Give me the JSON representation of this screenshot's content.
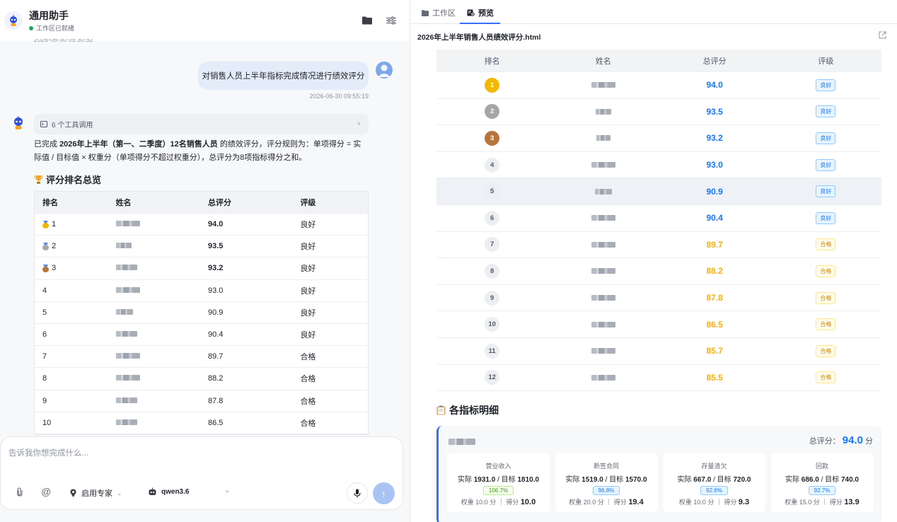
{
  "app": {
    "title": "通用助手",
    "status": "工作区已就绪"
  },
  "chat": {
    "prev_timestamp": "2026-06-30 09:30:52",
    "user_message": "对销售人员上半年指标完成情况进行绩效评分",
    "user_timestamp": "2026-06-30 09:55:19",
    "tool_calls": "6 个工具调用",
    "para_pre": "已完成 ",
    "para_bold": "2026年上半年（第一、二季度）12名销售人员",
    "para_post": " 的绩效评分，评分规则为：单项得分 = 实际值 / 目标值 × 权重分（单项得分不超过权重分），总评分为8项指标得分之和。",
    "section_title": "评分排名总览",
    "table": {
      "headers": [
        "排名",
        "姓名",
        "总评分",
        "评级"
      ],
      "rows": [
        {
          "rank": "1",
          "score": "94.0",
          "level": "良好"
        },
        {
          "rank": "2",
          "score": "93.5",
          "level": "良好"
        },
        {
          "rank": "3",
          "score": "93.2",
          "level": "良好"
        },
        {
          "rank": "4",
          "score": "93.0",
          "level": "良好"
        },
        {
          "rank": "5",
          "score": "90.9",
          "level": "良好"
        },
        {
          "rank": "6",
          "score": "90.4",
          "level": "良好"
        },
        {
          "rank": "7",
          "score": "89.7",
          "level": "合格"
        },
        {
          "rank": "8",
          "score": "88.2",
          "level": "合格"
        },
        {
          "rank": "9",
          "score": "87.8",
          "level": "合格"
        },
        {
          "rank": "10",
          "score": "86.5",
          "level": "合格"
        }
      ]
    }
  },
  "input": {
    "placeholder": "告诉我你想完成什么...",
    "expert": "启用专家",
    "model": "qwen3.6"
  },
  "preview": {
    "tabs": [
      "工作区",
      "预览"
    ],
    "filename": "2026年上半年销售人员绩效评分.html",
    "table_headers": [
      "排名",
      "姓名",
      "总评分",
      "评级"
    ],
    "rows": [
      {
        "rank": "1",
        "score": "94.0",
        "level": "良好"
      },
      {
        "rank": "2",
        "score": "93.5",
        "level": "良好"
      },
      {
        "rank": "3",
        "score": "93.2",
        "level": "良好"
      },
      {
        "rank": "4",
        "score": "93.0",
        "level": "良好"
      },
      {
        "rank": "5",
        "score": "90.9",
        "level": "良好"
      },
      {
        "rank": "6",
        "score": "90.4",
        "level": "良好"
      },
      {
        "rank": "7",
        "score": "89.7",
        "level": "合格"
      },
      {
        "rank": "8",
        "score": "88.2",
        "level": "合格"
      },
      {
        "rank": "9",
        "score": "87.8",
        "level": "合格"
      },
      {
        "rank": "10",
        "score": "86.5",
        "level": "合格"
      },
      {
        "rank": "11",
        "score": "85.7",
        "level": "合格"
      },
      {
        "rank": "12",
        "score": "85.5",
        "level": "合格"
      }
    ],
    "detail_title": "各指标明细",
    "card": {
      "total_label": "总评分：",
      "total_value": "94.0",
      "total_unit": "分",
      "metrics": [
        {
          "name": "营业收入",
          "actual": "1931.0",
          "target": "1810.0",
          "pct": "106.7%",
          "weight": "10.0",
          "score": "10.0"
        },
        {
          "name": "新签合同",
          "actual": "1519.0",
          "target": "1570.0",
          "pct": "96.8%",
          "weight": "20.0",
          "score": "19.4"
        },
        {
          "name": "存量清欠",
          "actual": "667.0",
          "target": "720.0",
          "pct": "92.6%",
          "weight": "10.0",
          "score": "9.3"
        },
        {
          "name": "回款",
          "actual": "686.0",
          "target": "740.0",
          "pct": "92.7%",
          "weight": "15.0",
          "score": "13.9"
        }
      ]
    }
  },
  "colors": {
    "accent": "#3370ff",
    "good": "#1677ff",
    "pass": "#faad14",
    "gold": "#f5b800",
    "silver": "#a6a6a6",
    "bronze": "#b8743b"
  }
}
